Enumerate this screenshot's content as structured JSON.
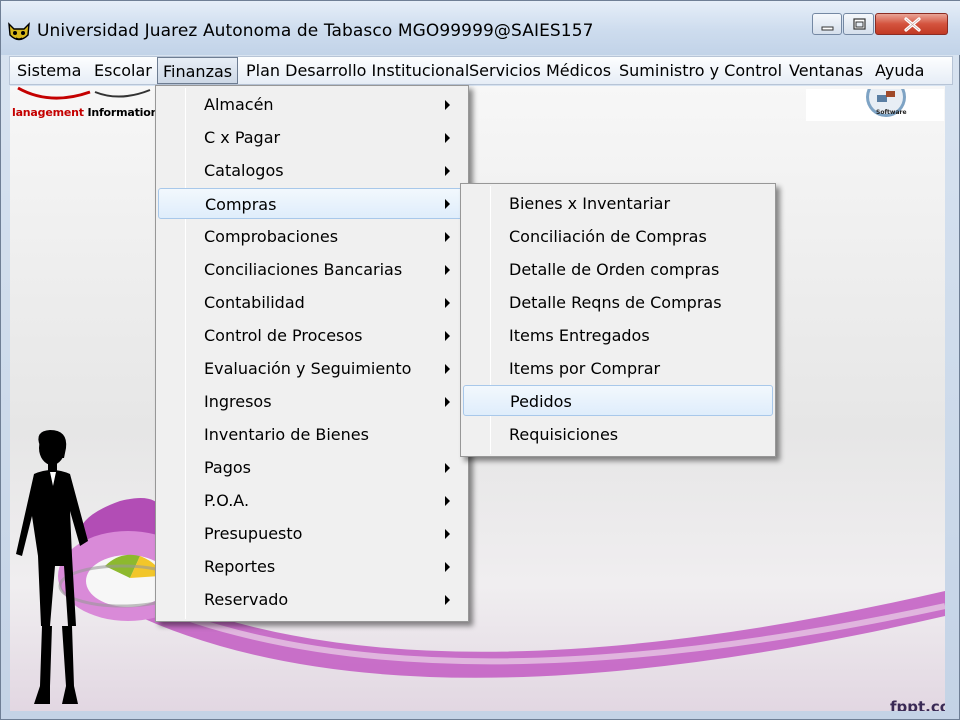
{
  "window": {
    "title": "Universidad Juarez Autonoma de Tabasco MGO99999@SAIES157"
  },
  "menubar": [
    {
      "label": "Sistema"
    },
    {
      "label": "Escolar"
    },
    {
      "label": "Finanzas"
    },
    {
      "label": "Plan Desarrollo Institucional"
    },
    {
      "label": "Servicios Médicos"
    },
    {
      "label": "Suministro y Control"
    },
    {
      "label": "Ventanas"
    },
    {
      "label": "Ayuda"
    }
  ],
  "finanzas_menu": [
    {
      "label": "Almacén",
      "submenu": true
    },
    {
      "label": "C x Pagar",
      "submenu": true
    },
    {
      "label": "Catalogos",
      "submenu": true
    },
    {
      "label": "Compras",
      "submenu": true,
      "highlighted": true
    },
    {
      "label": "Comprobaciones",
      "submenu": true
    },
    {
      "label": "Conciliaciones Bancarias",
      "submenu": true
    },
    {
      "label": "Contabilidad",
      "submenu": true
    },
    {
      "label": "Control de Procesos",
      "submenu": true
    },
    {
      "label": "Evaluación y Seguimiento",
      "submenu": true
    },
    {
      "label": "Ingresos",
      "submenu": true
    },
    {
      "label": "Inventario de Bienes",
      "submenu": false
    },
    {
      "label": "Pagos",
      "submenu": true
    },
    {
      "label": "P.O.A.",
      "submenu": true
    },
    {
      "label": "Presupuesto",
      "submenu": true
    },
    {
      "label": "Reportes",
      "submenu": true
    },
    {
      "label": "Reservado",
      "submenu": true
    }
  ],
  "compras_menu": [
    {
      "label": "Bienes x Inventariar"
    },
    {
      "label": "Conciliación de Compras"
    },
    {
      "label": "Detalle de Orden compras"
    },
    {
      "label": "Detalle Reqns de Compras"
    },
    {
      "label": "Items Entregados"
    },
    {
      "label": "Items por Comprar"
    },
    {
      "label": "Pedidos",
      "highlighted": true
    },
    {
      "label": "Requisiciones"
    }
  ],
  "background": {
    "mis_logo_prefix": "lanagement",
    "mis_logo_rest": "Information Sys",
    "software_logo_text": "Software",
    "watermark": "fppt.co"
  },
  "colors": {
    "menu_highlight": "#dfedfb",
    "close_button": "#c13a24",
    "accent_purple": "#c25bc2"
  },
  "icons": {
    "app": "cat-face-icon",
    "submenu": "chevron-right-icon"
  }
}
